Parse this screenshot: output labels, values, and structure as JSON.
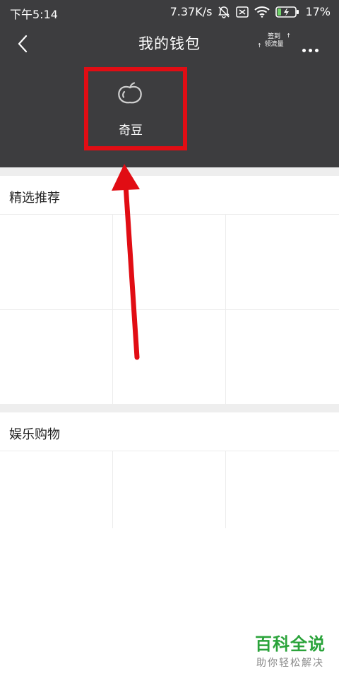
{
  "status_bar": {
    "time": "下午5:14",
    "network_speed": "7.37K/s",
    "battery": "17%"
  },
  "nav": {
    "title": "我的钱包",
    "checkin_line1": "签到",
    "checkin_line2": "领流量"
  },
  "wallet": {
    "item_label": "奇豆"
  },
  "sections": [
    {
      "title": "精选推荐"
    },
    {
      "title": "娱乐购物"
    }
  ],
  "watermark": {
    "title": "百科全说",
    "subtitle": "助你轻松解决"
  },
  "colors": {
    "header_bg": "#3d3d3f",
    "highlight": "#e10d14",
    "watermark_green": "#2aa33a"
  }
}
